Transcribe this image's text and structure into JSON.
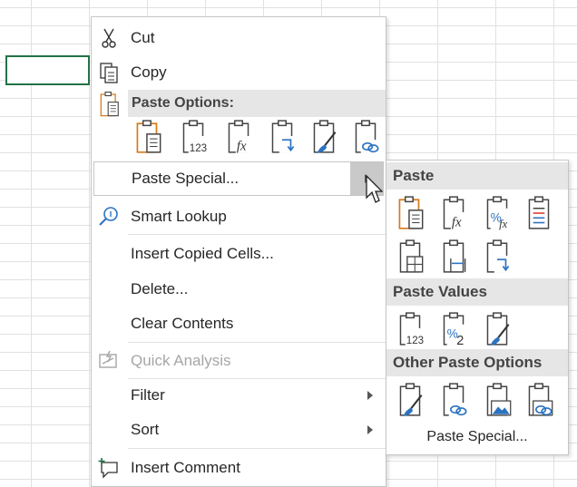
{
  "menu": {
    "cut": "Cut",
    "copy": "Copy",
    "paste_options_header": "Paste Options:",
    "paste_special": "Paste Special...",
    "smart_lookup": "Smart Lookup",
    "insert_copied_cells": "Insert Copied Cells...",
    "delete": "Delete...",
    "clear_contents": "Clear Contents",
    "quick_analysis": "Quick Analysis",
    "filter": "Filter",
    "sort": "Sort",
    "insert_comment": "Insert Comment",
    "paste_option_icons": [
      "paste-icon",
      "paste-values-icon",
      "paste-formulas-icon",
      "paste-transpose-icon",
      "paste-formatting-icon",
      "paste-link-icon"
    ]
  },
  "submenu": {
    "paste_header": "Paste",
    "paste_values_header": "Paste Values",
    "other_paste_header": "Other Paste Options",
    "paste_special": "Paste Special...",
    "paste_icons": [
      "paste-icon",
      "paste-formulas-icon",
      "paste-formulas-number-format-icon",
      "paste-keep-source-formatting-icon",
      "paste-no-borders-icon",
      "paste-keep-column-widths-icon",
      "paste-transpose-icon"
    ],
    "values_icons": [
      "paste-values-icon",
      "paste-values-number-format-icon",
      "paste-values-source-formatting-icon"
    ],
    "other_icons": [
      "paste-formatting-icon",
      "paste-link-icon",
      "paste-picture-icon",
      "paste-linked-picture-icon"
    ]
  },
  "colors": {
    "accent_orange": "#d47b1c",
    "accent_blue": "#2b73c0",
    "header_bg": "#e6e6e6",
    "selection_green": "#217346"
  }
}
